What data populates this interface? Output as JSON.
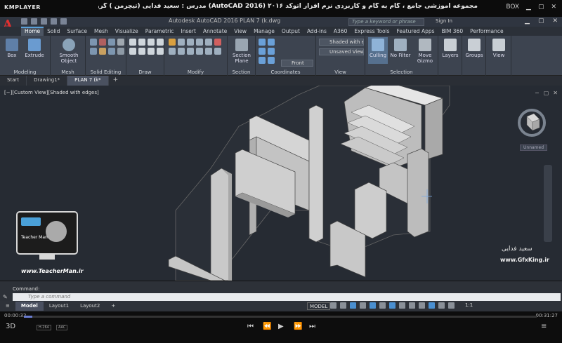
{
  "player": {
    "logo": "KMPLAYER",
    "title": "مجموعه آموزشی جامع ، گام به گام و کاربردی نرم افزار  اتوکد ۲۰۱۶ (AutoCAD 2016)  مدرس : سعید فدایی (تیچرمن ) گروه آموزشی پادشاه گرافیست ها",
    "badge_box": "BOX",
    "time_current": "00:00:32",
    "time_total": "00:31:27",
    "progress_fraction": 0.017,
    "seek_fill_color": "#6a7cd0",
    "badge_3d": "3D",
    "badge_1": "H.264",
    "badge_2": "AAC"
  },
  "cad": {
    "app_letter": "A",
    "window_title": "Autodesk AutoCAD 2016    PLAN 7 (k.dwg",
    "search_placeholder": "Type a keyword or phrase",
    "sign_in": "Sign In",
    "ribbon_tabs": [
      "Home",
      "Solid",
      "Surface",
      "Mesh",
      "Visualize",
      "Parametric",
      "Insert",
      "Annotate",
      "View",
      "Manage",
      "Output",
      "Add-ins",
      "A360",
      "Express Tools",
      "Featured Apps",
      "BIM 360",
      "Performance"
    ],
    "ribbon": {
      "box": "Box",
      "extrude": "Extrude",
      "smooth_object": "Smooth Object",
      "section_plane": "Section Plane",
      "culling": "Culling",
      "no_filter": "No Filter",
      "move_gizmo": "Move Gizmo",
      "layers": "Layers",
      "groups": "Groups",
      "view": "View",
      "visual_style": "Shaded with e...",
      "saved_view": "Unsaved View",
      "front": "Front"
    },
    "groups": {
      "modeling": "Modeling",
      "mesh": "Mesh",
      "solid_editing": "Solid Editing",
      "draw": "Draw",
      "modify": "Modify",
      "section": "Section",
      "coordinates": "Coordinates",
      "view": "View",
      "selection": "Selection"
    },
    "file_tabs": [
      "Start",
      "Drawing1*",
      "PLAN 7 (k*"
    ],
    "viewport_label": "[−][Custom View][Shaded with edges]",
    "ucs_label": "Unnamed",
    "command_history": "Command:",
    "command_placeholder": "Type a command",
    "layout_tabs": [
      "Model",
      "Layout1",
      "Layout2"
    ],
    "model_toggle": "MODEL",
    "scale": "1:1"
  },
  "watermark": {
    "site": "www.TeacherMan.ir",
    "name_fa": "سعید فدایی",
    "gfx": "www.GfxKing.ir",
    "teacher_label": "Teacher Man"
  }
}
